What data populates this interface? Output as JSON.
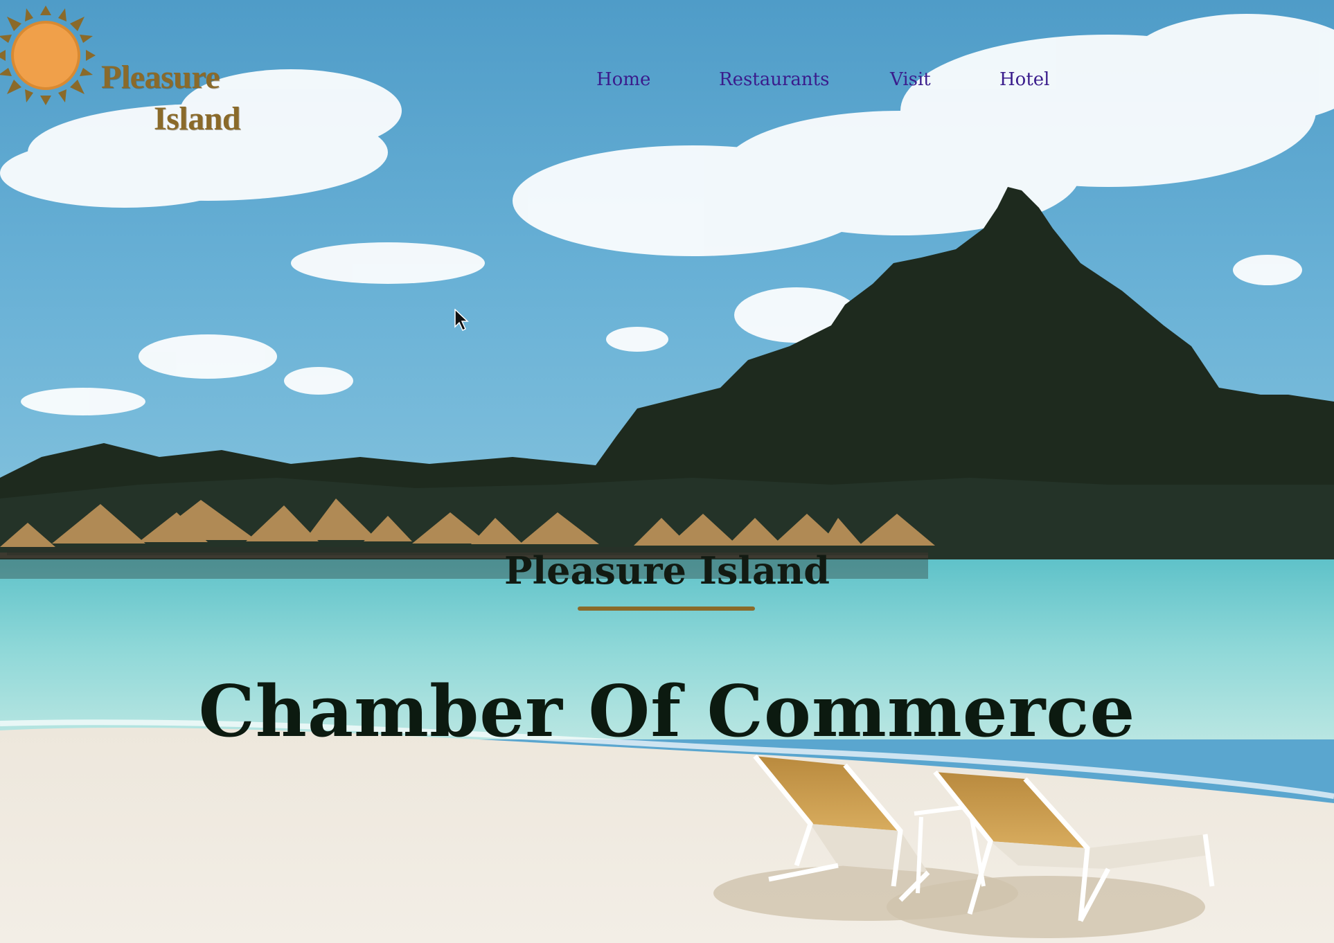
{
  "brand": {
    "logo_line1": "Pleasure",
    "logo_line2": "Island",
    "logo_color": "#8a6a2a",
    "sun_color": "#f0a04a"
  },
  "nav": {
    "items": [
      "Home",
      "Restaurants",
      "Visit",
      "Hotel"
    ],
    "link_color": "#3a1c8c"
  },
  "hero": {
    "subtitle": "Pleasure Island",
    "title": "Chamber Of Commerce",
    "accent_color": "#8a6a2a"
  },
  "icons": [
    "sun-icon",
    "mouse-cursor-icon"
  ]
}
